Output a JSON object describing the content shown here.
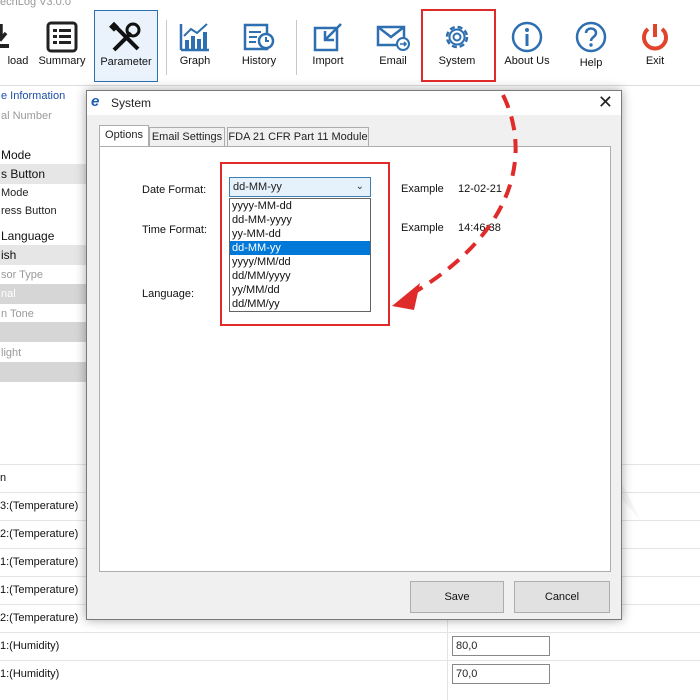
{
  "app": {
    "title": "echLog V3.0.0"
  },
  "toolbar": {
    "items": [
      {
        "label": "load"
      },
      {
        "label": "Summary"
      },
      {
        "label": "Parameter"
      },
      {
        "label": "Graph"
      },
      {
        "label": "History"
      },
      {
        "label": "Import"
      },
      {
        "label": "Email"
      },
      {
        "label": "System"
      },
      {
        "label": "About Us"
      },
      {
        "label": "Help"
      },
      {
        "label": "Exit"
      }
    ]
  },
  "left_panel": {
    "items": [
      {
        "text": "e Information"
      },
      {
        "text": "al Number"
      },
      {
        "text": "Mode"
      },
      {
        "text": "s Button"
      },
      {
        "text": "Mode"
      },
      {
        "text": "ress Button"
      },
      {
        "text": "Language"
      },
      {
        "text": "ish"
      },
      {
        "text": "sor Type"
      },
      {
        "text": "nal"
      },
      {
        "text": "n Tone"
      },
      {
        "text": "light"
      }
    ]
  },
  "grid": {
    "rows": [
      {
        "label": "n",
        "value": ""
      },
      {
        "label": "3:(Temperature)",
        "value": ""
      },
      {
        "label": "2:(Temperature)",
        "value": ""
      },
      {
        "label": "1:(Temperature)",
        "value": ""
      },
      {
        "label": "1:(Temperature)",
        "value": ""
      },
      {
        "label": "2:(Temperature)",
        "value": ""
      },
      {
        "label": "1:(Humidity)",
        "value": "80,0"
      },
      {
        "label": "1:(Humidity)",
        "value": "70,0"
      }
    ]
  },
  "dialog": {
    "title": "System",
    "close": "✕",
    "tabs": [
      {
        "label": "Options"
      },
      {
        "label": "Email Settings"
      },
      {
        "label": "FDA 21 CFR Part 11 Module"
      }
    ],
    "date_format_label": "Date Format:",
    "date_format_value": "dd-MM-yy",
    "date_example_label": "Example",
    "date_example_value": "12-02-21",
    "time_format_label": "Time Format:",
    "time_example_label": "Example",
    "time_example_value": "14:46:38",
    "language_label": "Language:",
    "dropdown_options": [
      "yyyy-MM-dd",
      "dd-MM-yyyy",
      "yy-MM-dd",
      "dd-MM-yy",
      "yyyy/MM/dd",
      "dd/MM/yyyy",
      "yy/MM/dd",
      "dd/MM/yy"
    ],
    "dropdown_selected": "dd-MM-yy",
    "save_label": "Save",
    "cancel_label": "Cancel"
  },
  "colors": {
    "highlight": "#e02b2b",
    "selection": "#0078d7",
    "icon_blue": "#2d6fb0",
    "exit_red": "#e0442b"
  },
  "icons": [
    "download-icon",
    "summary-icon",
    "tools-icon",
    "graph-icon",
    "history-icon",
    "import-icon",
    "email-icon",
    "gear-icon",
    "info-icon",
    "help-icon",
    "power-icon",
    "e-logo-icon",
    "close-icon",
    "chevron-down-icon"
  ]
}
